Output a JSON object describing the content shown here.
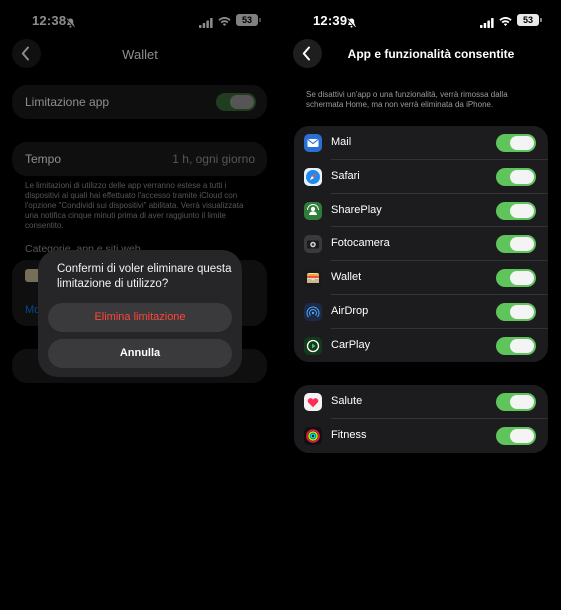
{
  "left": {
    "status": {
      "time": "12:38",
      "battery": "53"
    },
    "nav": {
      "title": "Wallet"
    },
    "limit_row": {
      "label": "Limitazione app",
      "enabled": true
    },
    "time_row": {
      "label": "Tempo",
      "value": "1 h, ogni giorno"
    },
    "footer_note": "Le limitazioni di utilizzo delle app verranno estese a tutti i dispositivi ai quali hai effettuato l'accesso tramite iCloud con l'opzione \"Condividi sui dispositivi\" abilitata. Verrà visualizzata una notifica cinque minuti prima di aver raggiunto il limite consentito.",
    "section_header": "Categorie, app e siti web",
    "link_partial": "Mo",
    "alert": {
      "message": "Confermi di voler eliminare questa limitazione di utilizzo?",
      "destructive_label": "Elimina limitazione",
      "cancel_label": "Annulla"
    }
  },
  "right": {
    "status": {
      "time": "12:39",
      "battery": "53"
    },
    "nav": {
      "title": "App e funzionalità consentite"
    },
    "info_text": "Se disattivi un'app o una funzionalità, verrà rimossa dalla schermata Home, ma non verrà eliminata da iPhone.",
    "group1": [
      {
        "name": "Mail",
        "icon": "mail-icon",
        "on": true
      },
      {
        "name": "Safari",
        "icon": "safari-icon",
        "on": true
      },
      {
        "name": "SharePlay",
        "icon": "shareplay-icon",
        "on": true
      },
      {
        "name": "Fotocamera",
        "icon": "camera-icon",
        "on": true
      },
      {
        "name": "Wallet",
        "icon": "wallet-icon",
        "on": true
      },
      {
        "name": "AirDrop",
        "icon": "airdrop-icon",
        "on": true
      },
      {
        "name": "CarPlay",
        "icon": "carplay-icon",
        "on": true
      }
    ],
    "group2": [
      {
        "name": "Salute",
        "icon": "health-icon",
        "on": true
      },
      {
        "name": "Fitness",
        "icon": "fitness-icon",
        "on": true
      }
    ]
  },
  "colors": {
    "toggle_on": "#5fc45c",
    "destructive": "#ff453a",
    "card": "#1c1c1e",
    "link": "#0a84ff"
  }
}
